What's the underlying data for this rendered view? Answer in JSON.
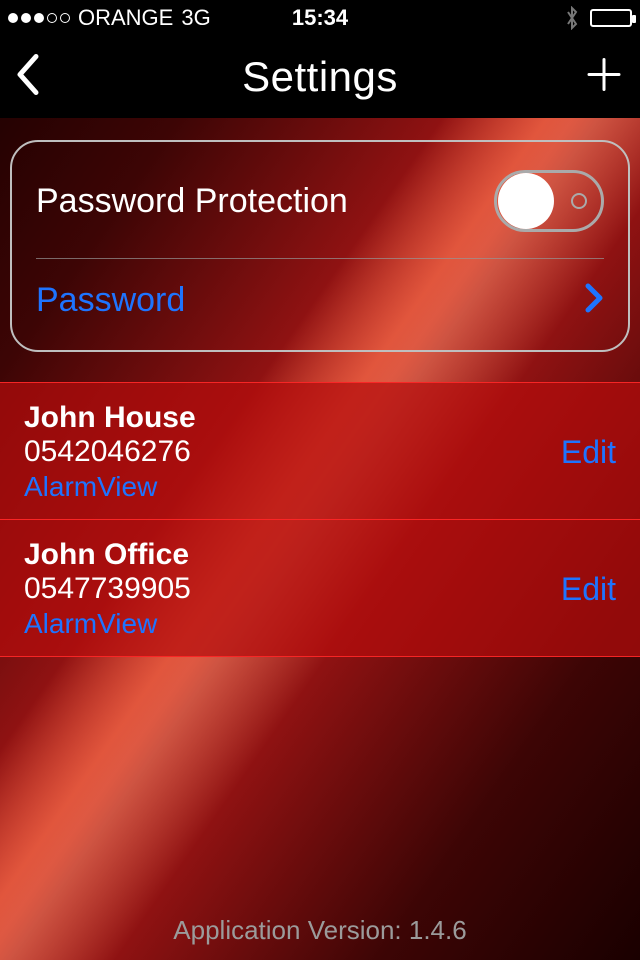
{
  "status": {
    "carrier": "ORANGE",
    "network": "3G",
    "time": "15:34"
  },
  "nav": {
    "title": "Settings"
  },
  "card": {
    "password_protection_label": "Password Protection",
    "password_link_label": "Password"
  },
  "panels": [
    {
      "name": "John House",
      "number": "0542046276",
      "type": "AlarmView",
      "action": "Edit"
    },
    {
      "name": "John Office",
      "number": "0547739905",
      "type": "AlarmView",
      "action": "Edit"
    }
  ],
  "footer": {
    "version_label": "Application Version: 1.4.6"
  }
}
